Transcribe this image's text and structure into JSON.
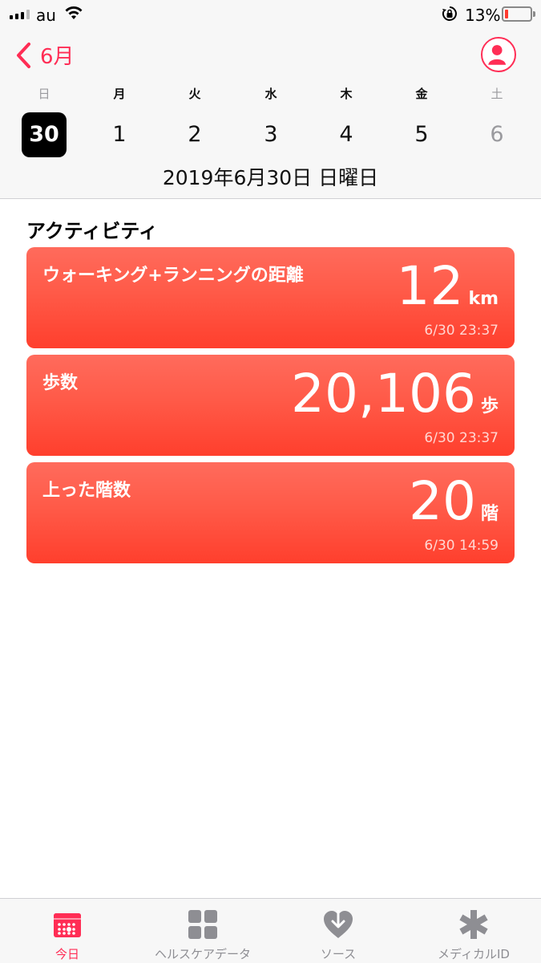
{
  "status_bar": {
    "carrier": "au",
    "battery_percent": "13%",
    "battery_level": 0.13,
    "icons": [
      "signal-icon",
      "wifi-icon",
      "orientation-lock-icon",
      "battery-icon"
    ]
  },
  "header": {
    "back_label": "6月",
    "weekday_labels": [
      "日",
      "月",
      "火",
      "水",
      "木",
      "金",
      "土"
    ],
    "days": [
      "30",
      "1",
      "2",
      "3",
      "4",
      "5",
      "6"
    ],
    "selected_day_index": 0,
    "date_title": "2019年6月30日 日曜日"
  },
  "section": {
    "title": "アクティビティ"
  },
  "cards": [
    {
      "label": "ウォーキング+ランニングの距離",
      "value": "12",
      "unit": "km",
      "time": "6/30 23:37"
    },
    {
      "label": "歩数",
      "value": "20,106",
      "unit": "歩",
      "time": "6/30 23:37"
    },
    {
      "label": "上った階数",
      "value": "20",
      "unit": "階",
      "time": "6/30 14:59"
    }
  ],
  "tabs": [
    {
      "label": "今日",
      "icon": "today-icon",
      "active": true
    },
    {
      "label": "ヘルスケアデータ",
      "icon": "grid-icon",
      "active": false
    },
    {
      "label": "ソース",
      "icon": "heart-download-icon",
      "active": false
    },
    {
      "label": "メディカルID",
      "icon": "asterisk-icon",
      "active": false
    }
  ],
  "colors": {
    "accent": "#ff2d55",
    "card_top": "#ff6b5c",
    "card_bottom": "#ff3f2d",
    "battery_low": "#ff3b30"
  }
}
